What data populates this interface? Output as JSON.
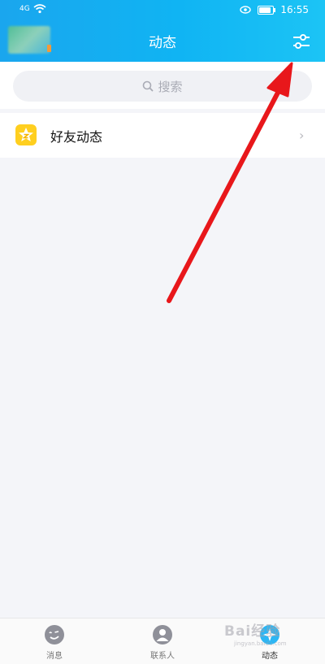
{
  "status_bar": {
    "time": "16:55",
    "signal_text": "4G"
  },
  "header": {
    "title": "动态"
  },
  "search": {
    "placeholder": "搜索"
  },
  "rows": [
    {
      "label": "好友动态",
      "icon": "qzone-star-icon"
    }
  ],
  "tabs": [
    {
      "label": "消息",
      "icon": "message-icon",
      "active": false
    },
    {
      "label": "联系人",
      "icon": "contacts-icon",
      "active": false
    },
    {
      "label": "动态",
      "icon": "explore-icon",
      "active": true
    }
  ],
  "watermark": {
    "text": "Bai经验",
    "sub": "jingyan.baidu.com"
  },
  "colors": {
    "header_start": "#1aa6ee",
    "header_end": "#1cc4f5",
    "arrow": "#e8171b",
    "qzone_icon": "#ffcf1f"
  }
}
